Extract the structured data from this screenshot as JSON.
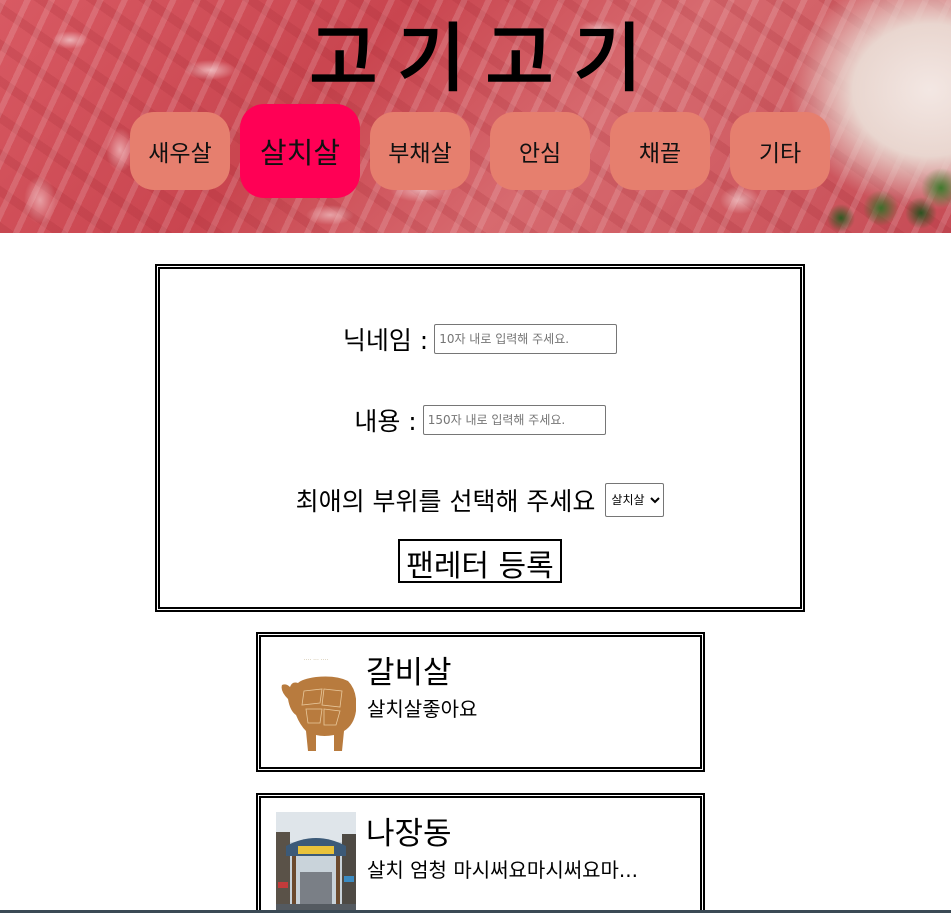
{
  "header": {
    "title": "고기고기",
    "nav": [
      {
        "label": "새우살",
        "active": false
      },
      {
        "label": "살치살",
        "active": true
      },
      {
        "label": "부채살",
        "active": false
      },
      {
        "label": "안심",
        "active": false
      },
      {
        "label": "채끝",
        "active": false
      },
      {
        "label": "기타",
        "active": false
      }
    ]
  },
  "form": {
    "nickname_label": "닉네임 :",
    "nickname_placeholder": "10자 내로 입력해 주세요.",
    "content_label": "내용 :",
    "content_placeholder": "150자 내로 입력해 주세요.",
    "select_label": "최애의 부위를 선택해 주세요",
    "select_value": "살치살",
    "submit_label": "팬레터 등록"
  },
  "cards": [
    {
      "nickname": "갈비살",
      "content": "살치살좋아요",
      "thumb_icon": "cow-cuts-icon"
    },
    {
      "nickname": "나장동",
      "content": "살치 엄청 마시써요마시써요마...",
      "thumb_icon": "market-street-photo"
    }
  ],
  "colors": {
    "nav_button": "#e67f6e",
    "nav_active": "#ff0055"
  }
}
